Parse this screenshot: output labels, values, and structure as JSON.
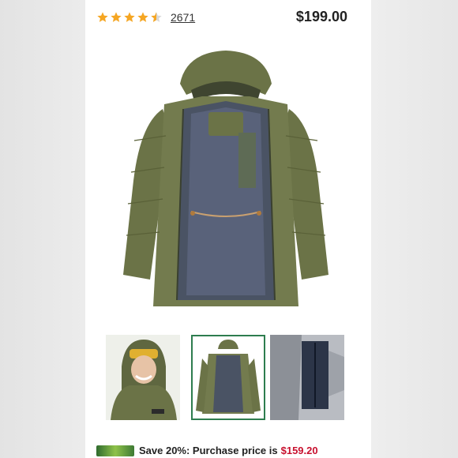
{
  "product": {
    "rating": 4.5,
    "review_count": "2671",
    "price": "$199.00"
  },
  "gallery": {
    "hero": "parka-front-open",
    "thumbnails": [
      {
        "subject": "model-wearing-hood",
        "selected": false
      },
      {
        "subject": "parka-front-open",
        "selected": true
      },
      {
        "subject": "interior-pocket-detail",
        "selected": false
      }
    ]
  },
  "promo": {
    "text": "Save 20%: Purchase price is",
    "price": "$159.20"
  },
  "colors": {
    "star": "#f5a623",
    "jacket": "#6b7347",
    "lining": "#4a5364",
    "selected_border": "#2e7d4f",
    "promo_price": "#c8102e"
  },
  "icons": {
    "star": "star-icon",
    "half_star": "half-star-icon",
    "card": "credit-card-icon"
  }
}
